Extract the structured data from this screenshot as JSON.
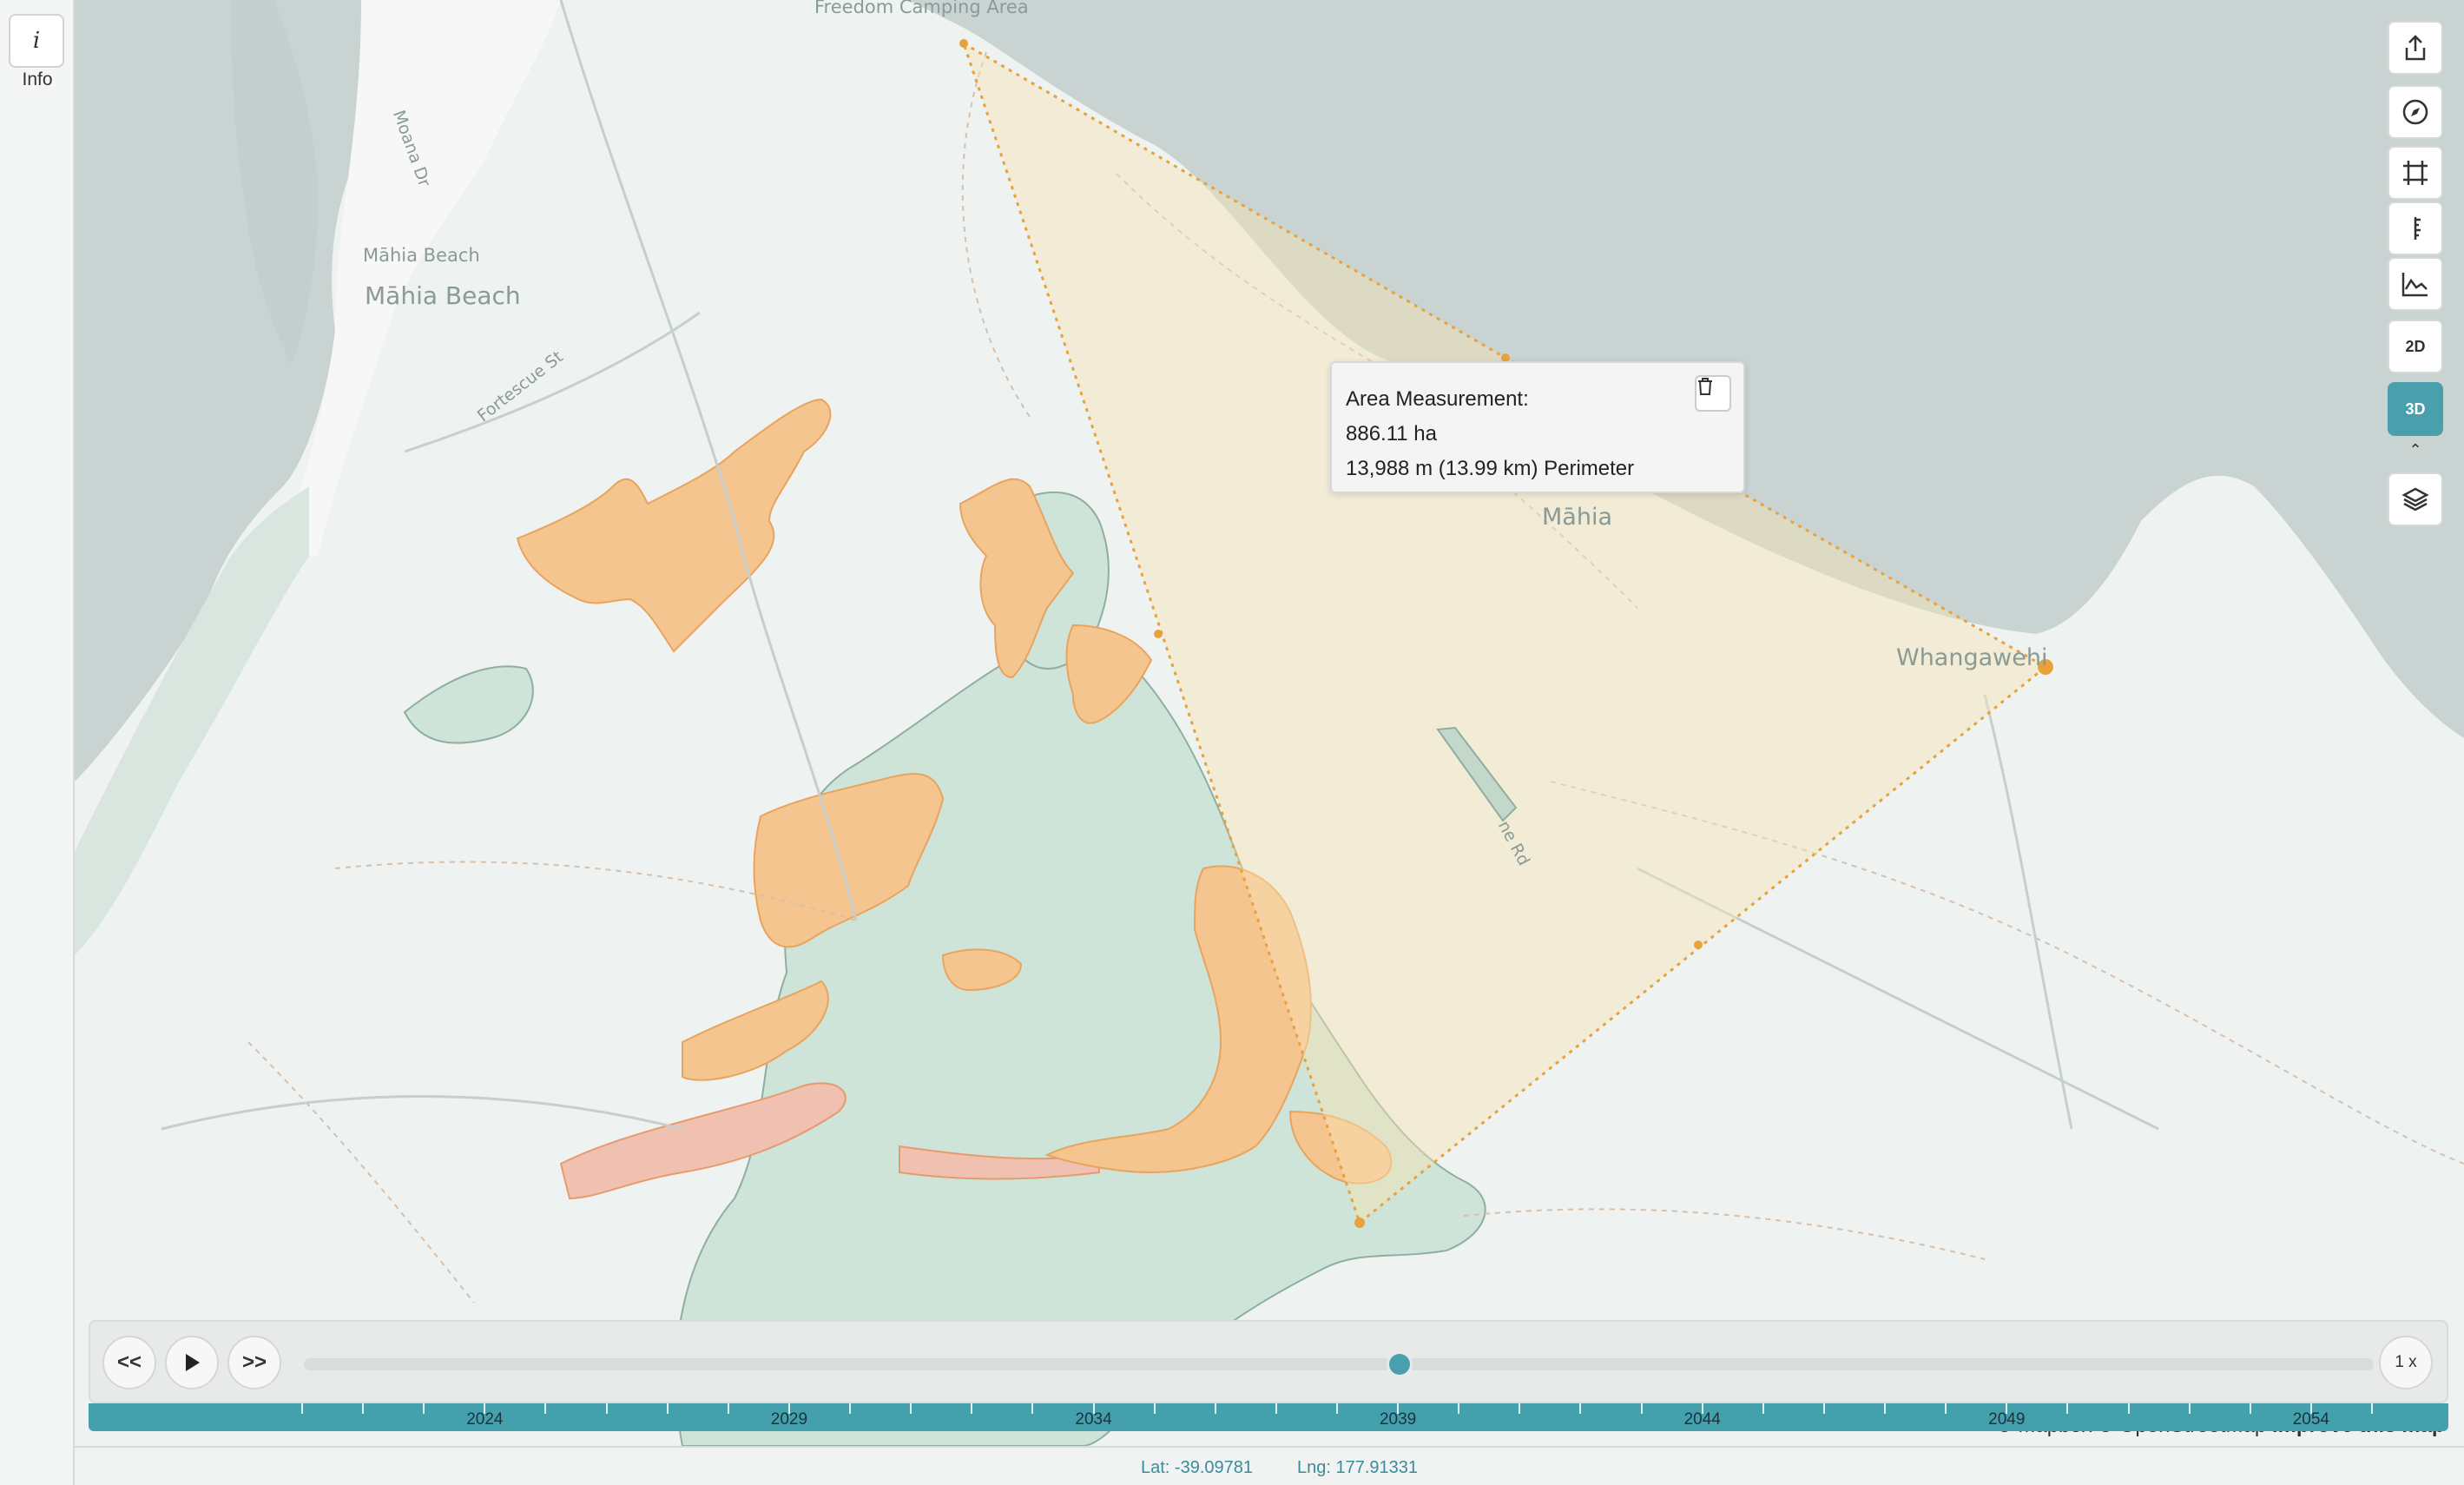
{
  "sidebar": {
    "info_icon": "i",
    "info_label": "Info"
  },
  "map": {
    "labels": {
      "camping": "Freedom Camping Area",
      "moana": "Moana Dr",
      "mahia_beach_small": "Māhia Beach",
      "mahia_beach": "Māhia Beach",
      "fortescue": "Fortescue St",
      "mahia": "Māhia",
      "whangawehi": "Whangawehi",
      "road": "ne Rd"
    }
  },
  "measurement": {
    "title": "Area Measurement:",
    "area": "886.11 ha",
    "perimeter": "13,988 m (13.99 km) Perimeter",
    "delete_icon": "trash-icon"
  },
  "toolbar": {
    "buttons": [
      {
        "name": "share-icon",
        "active": false
      },
      {
        "name": "compass-icon",
        "active": false
      },
      {
        "name": "frame-icon",
        "active": false
      },
      {
        "name": "ruler-icon",
        "active": false
      },
      {
        "name": "elevation-profile-icon",
        "active": false
      },
      {
        "name": "2d-icon",
        "label": "2D",
        "active": false
      },
      {
        "name": "3d-icon",
        "label": "3D",
        "active": true
      },
      {
        "name": "layers-icon",
        "active": false
      }
    ],
    "accent_color": "#4a9fad"
  },
  "timeline": {
    "rewind_label": "<<",
    "forward_label": ">>",
    "speed": "1 x",
    "years": [
      "2024",
      "2029",
      "2034",
      "2039",
      "2044",
      "2049",
      "2054"
    ],
    "start_year": 2021,
    "end_year": 2055,
    "current_year": 2039
  },
  "attribution": {
    "mapbox": "© Mapbox",
    "osm": "© OpenStreetMap",
    "improve": "Improve this map"
  },
  "status": {
    "lat": "Lat: -39.09781",
    "lng": "Lng: 177.91331"
  }
}
